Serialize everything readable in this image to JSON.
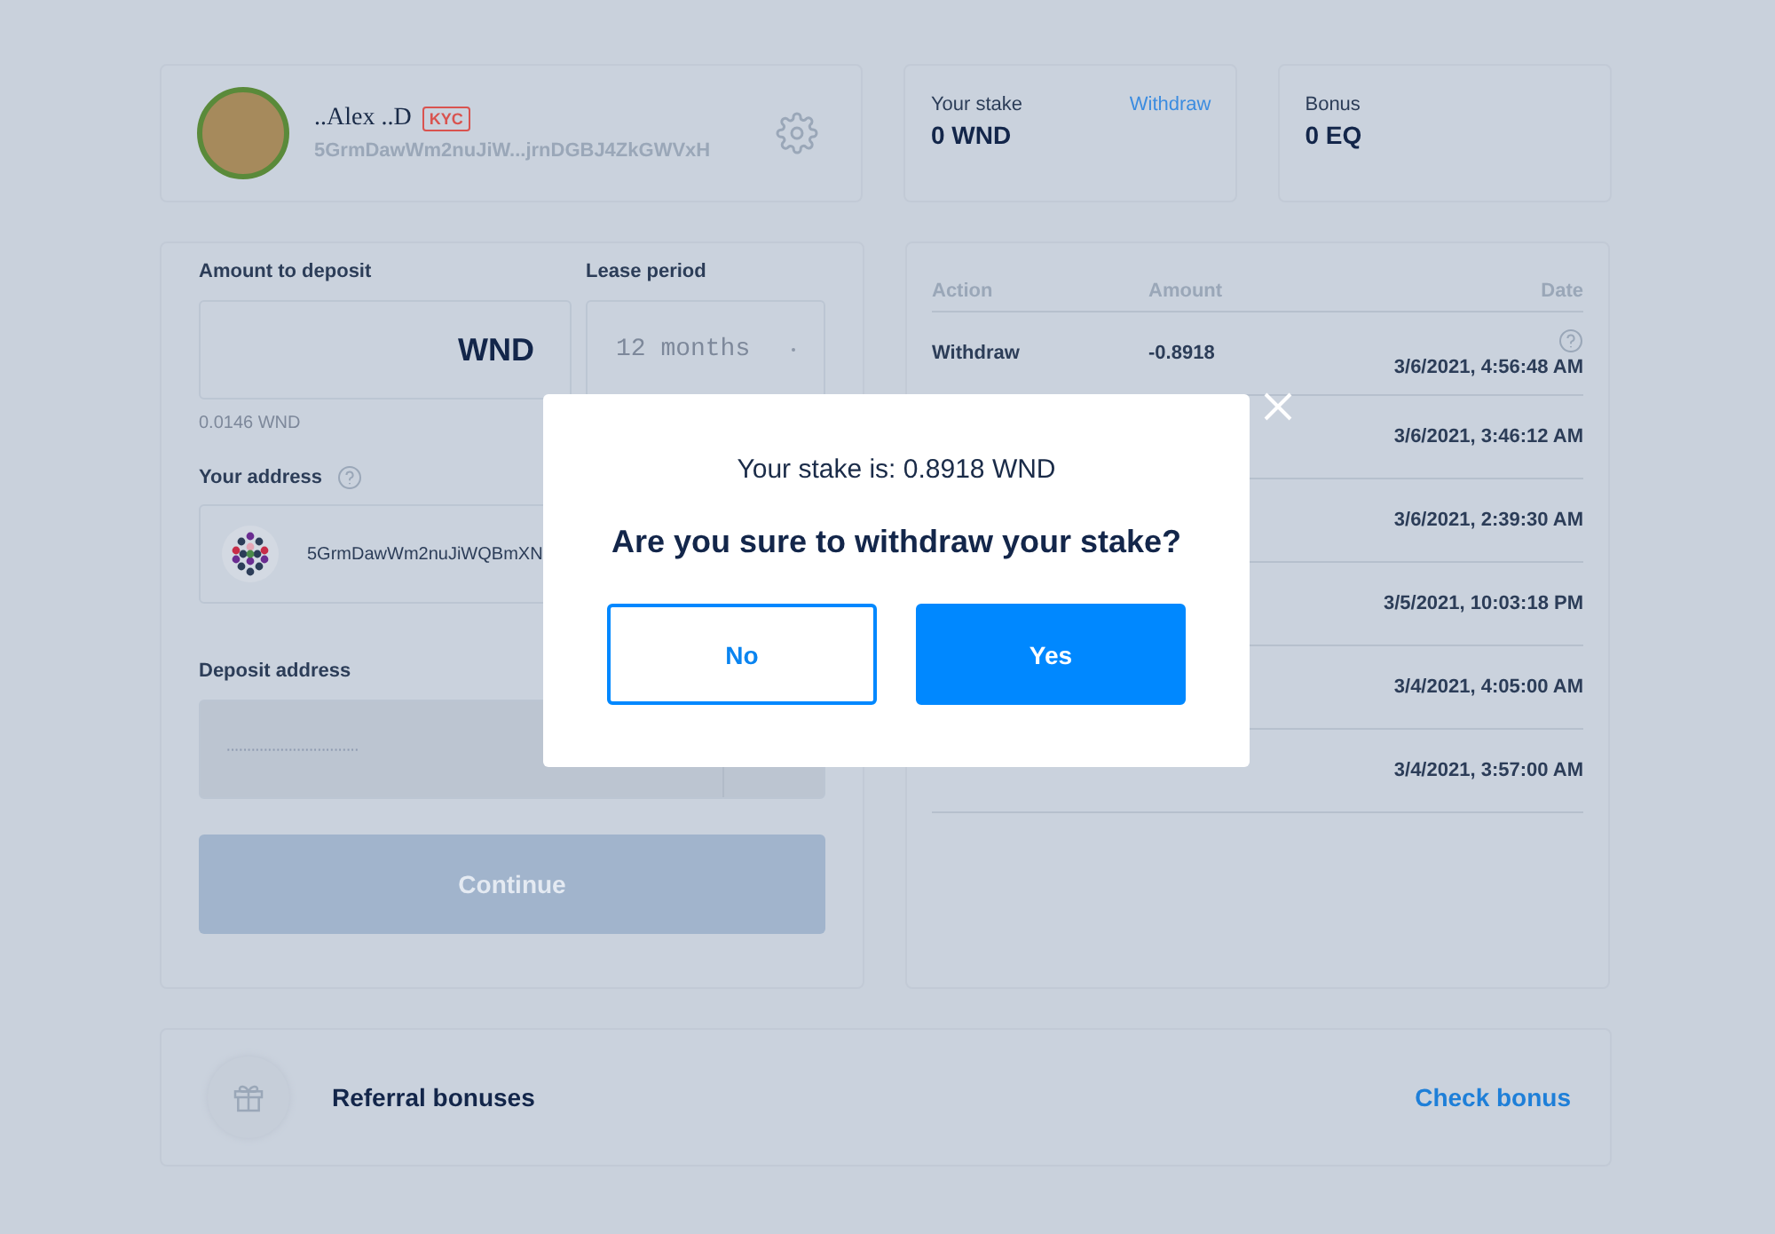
{
  "profile": {
    "name": "..Alex ..D",
    "badge": "KYC",
    "address": "5GrmDawWm2nuJiW...jrnDGBJ4ZkGWVxH"
  },
  "stake": {
    "label": "Your stake",
    "link": "Withdraw",
    "value": "0 WND"
  },
  "bonus": {
    "label": "Bonus",
    "value": "0 EQ"
  },
  "deposit_form": {
    "amount_label": "Amount to deposit",
    "amount_unit": "WND",
    "lease_label": "Lease period",
    "lease_value": "12 months",
    "balance": "0.0146 WND",
    "address_label": "Your address",
    "address_value": "5GrmDawWm2nuJiWQBmXN",
    "deposit_address_label": "Deposit address",
    "deposit_address_value": "································",
    "continue_button": {
      "label": "Continue",
      "disabled": true
    }
  },
  "history": {
    "columns": [
      "Action",
      "Amount",
      "Date"
    ],
    "rows": [
      {
        "action": "Withdraw",
        "amount": "-0.8918",
        "date": "3/6/2021, 4:56:48 AM",
        "help": true
      },
      {
        "date": "3/6/2021, 3:46:12 AM",
        "help": false
      },
      {
        "date": "3/6/2021, 2:39:30 AM",
        "help": false
      },
      {
        "date": "3/5/2021, 10:03:18 PM",
        "help": false
      },
      {
        "date": "3/4/2021, 4:05:00 AM",
        "help": false
      },
      {
        "date": "3/4/2021, 3:57:00 AM",
        "help": false
      }
    ]
  },
  "dialog": {
    "message": "Your stake is: 0.8918 WND",
    "question": "Are you sure to withdraw your stake?",
    "buttons": [
      {
        "label": "No",
        "kind": "outline"
      },
      {
        "label": "Yes",
        "kind": "primary"
      }
    ]
  },
  "referral": {
    "title": "Referral bonuses",
    "link": "Check bonus"
  }
}
